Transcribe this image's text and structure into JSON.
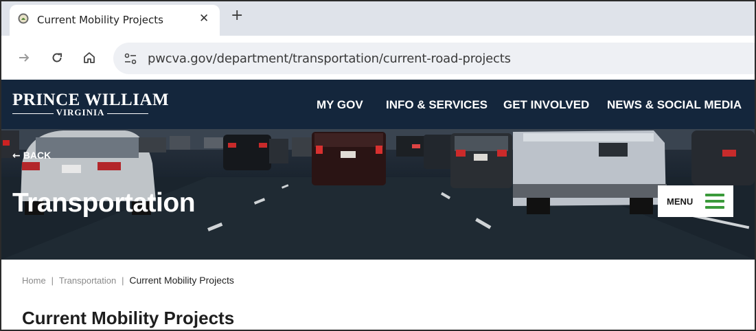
{
  "browser": {
    "tab_title": "Current Mobility Projects",
    "close_glyph": "✕",
    "new_tab_glyph": "+",
    "url": "pwcva.gov/department/transportation/current-road-projects",
    "icons": [
      "globe-favicon-icon",
      "forward-arrow-icon",
      "reload-icon",
      "home-icon",
      "site-info-icon"
    ]
  },
  "site": {
    "logo_main": "Prince William",
    "logo_sub": "Virginia",
    "nav": [
      "MY GOV",
      "INFO & SERVICES",
      "GET INVOLVED",
      "NEWS & SOCIAL MEDIA"
    ],
    "colors": {
      "header_bg": "#14263c",
      "menu_icon": "#3a9a3a"
    }
  },
  "hero": {
    "back_label": "BACK",
    "title": "Transportation",
    "menu_label": "MENU"
  },
  "breadcrumb": {
    "home": "Home",
    "section": "Transportation",
    "current": "Current Mobility Projects",
    "separator": "|"
  },
  "page": {
    "title": "Current Mobility Projects"
  }
}
